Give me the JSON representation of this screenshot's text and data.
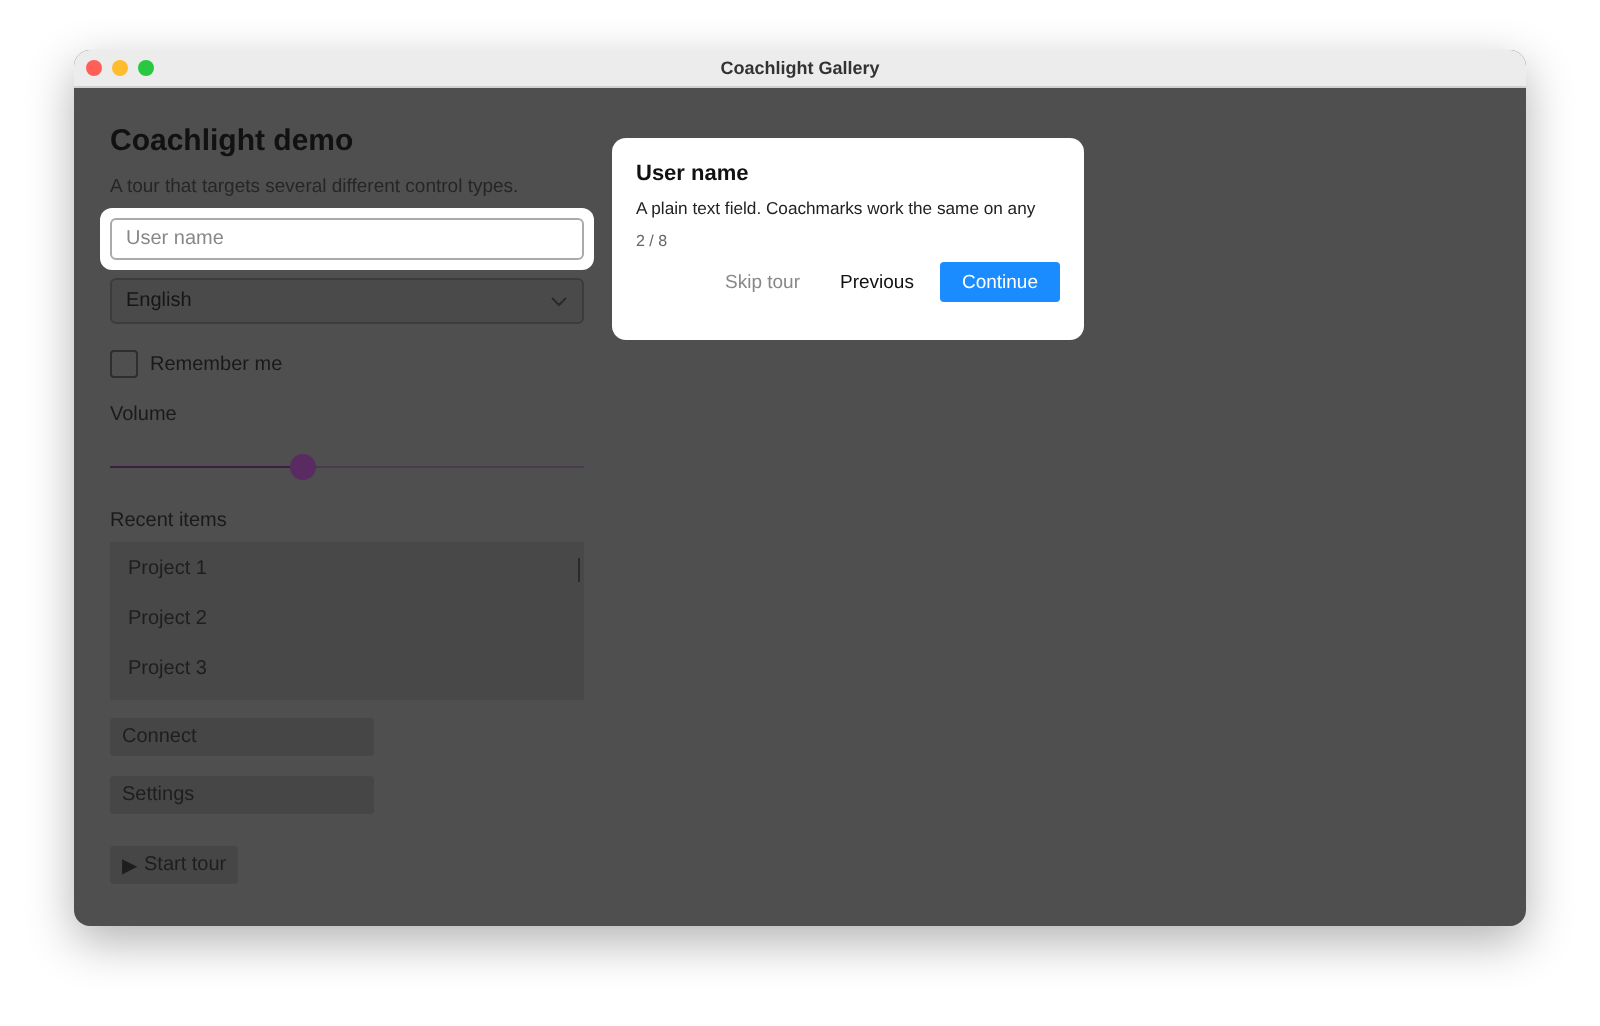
{
  "window": {
    "title": "Coachlight Gallery"
  },
  "heading": "Coachlight demo",
  "subtitle": "A tour that targets several different control types.",
  "username_field": {
    "placeholder": "User name",
    "highlighted": true
  },
  "language_select": {
    "value": "English"
  },
  "remember_checkbox": {
    "label": "Remember me",
    "checked": false
  },
  "volume": {
    "label": "Volume",
    "level": 0.405
  },
  "recent": {
    "label": "Recent items",
    "items": [
      {
        "label": "Project 1",
        "selected": false
      },
      {
        "label": "Project 2",
        "selected": false
      },
      {
        "label": "Project 3",
        "selected": false
      }
    ]
  },
  "buttons": [
    "Connect",
    "Settings"
  ],
  "start_button": {
    "icon": "▶",
    "label": "Start tour"
  },
  "coachmark": {
    "title": "User name",
    "body": "A plain text field. Coachmarks work the same on any",
    "step": "2 / 8",
    "skip": "Skip tour",
    "previous": "Previous",
    "next": "Continue"
  }
}
